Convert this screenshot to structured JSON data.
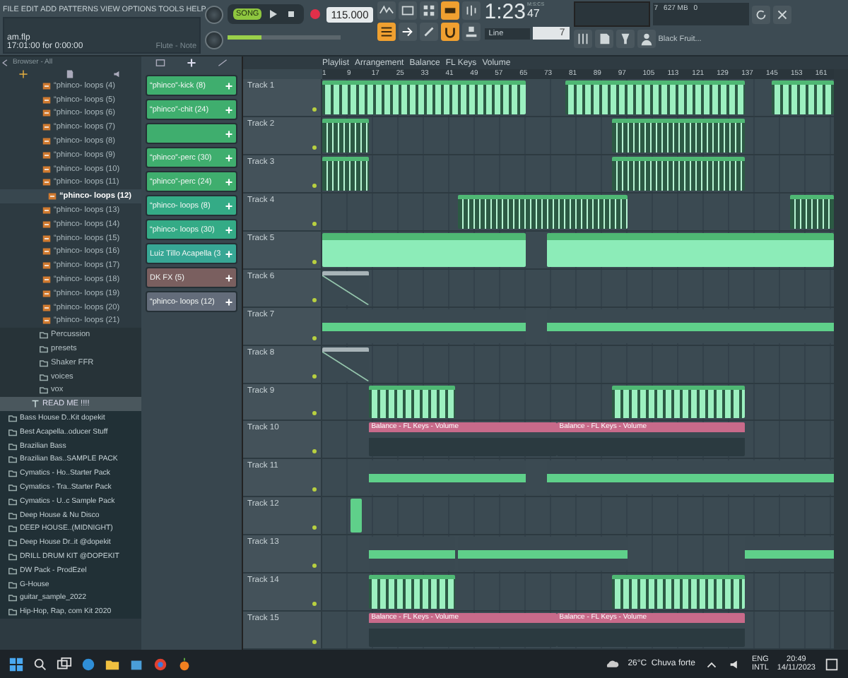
{
  "menu": [
    "FILE",
    "EDIT",
    "ADD",
    "PATTERNS",
    "VIEW",
    "OPTIONS",
    "TOOLS",
    "HELP"
  ],
  "hint": {
    "title": "am.flp",
    "line": "17:01:00 for 0:00:00",
    "right": "Flute - Note"
  },
  "transport": {
    "song": {
      "label": "SONG",
      "on": true
    },
    "tempo": "115.000",
    "time": "1:23",
    "time_small": "47",
    "time_unit": "M:S:CS",
    "master_volume": {
      "level": 0.3
    }
  },
  "monitor": {
    "voices": "7",
    "memory": "627 MB",
    "cpu": "0"
  },
  "snap": {
    "value": "Line"
  },
  "pattern": {
    "value": "7"
  },
  "preset": {
    "value": "Black Fruit..."
  },
  "browser": {
    "title": "Browser - All",
    "loops": [
      {
        "label": "“phinco- loops (4)",
        "selected": false
      },
      {
        "label": "“phinco- loops (5)",
        "selected": false
      },
      {
        "label": "“phinco- loops (6)",
        "selected": false
      },
      {
        "label": "“phinco- loops (7)",
        "selected": false
      },
      {
        "label": "“phinco- loops (8)",
        "selected": false
      },
      {
        "label": "“phinco- loops (9)",
        "selected": false
      },
      {
        "label": "“phinco- loops (10)",
        "selected": false
      },
      {
        "label": "“phinco- loops (11)",
        "selected": false
      },
      {
        "label": "“phinco- loops (12)",
        "selected": true
      },
      {
        "label": "“phinco- loops (13)",
        "selected": false
      },
      {
        "label": "“phinco- loops (14)",
        "selected": false
      },
      {
        "label": "“phinco- loops (15)",
        "selected": false
      },
      {
        "label": "“phinco- loops (16)",
        "selected": false
      },
      {
        "label": "“phinco- loops (17)",
        "selected": false
      },
      {
        "label": "“phinco- loops (18)",
        "selected": false
      },
      {
        "label": "“phinco- loops (19)",
        "selected": false
      },
      {
        "label": "“phinco- loops (20)",
        "selected": false
      },
      {
        "label": "“phinco- loops (21)",
        "selected": false
      }
    ],
    "folders": [
      {
        "label": "Percussion",
        "kind": "folder"
      },
      {
        "label": "presets",
        "kind": "folder"
      },
      {
        "label": "Shaker FFR",
        "kind": "folder"
      },
      {
        "label": "voices",
        "kind": "folder"
      },
      {
        "label": "vox",
        "kind": "folder"
      },
      {
        "label": "READ ME !!!!",
        "kind": "file"
      }
    ],
    "root_folders": [
      "Bass House D..Kit dopekit",
      "Best Acapella..oducer Stuff",
      "Brazilian Bass",
      "Brazilian Bas..SAMPLE PACK",
      "Cymatics - Ho..Starter Pack",
      "Cymatics - Tra..Starter Pack",
      "Cymatics - U..c Sample Pack",
      "Deep House & Nu Disco",
      "DEEP HOUSE..(MIDNIGHT)",
      "Deep House Dr..it @dopekit",
      "DRILL DRUM KIT @DOPEKIT",
      "DW Pack - ProdEzel",
      "G-House",
      "guitar_sample_2022",
      "Hip-Hop, Rap, com Kit 2020"
    ]
  },
  "channels": [
    {
      "name": "“phinco”-kick (8)",
      "color": "#3fae6e"
    },
    {
      "name": "“phinco”-chit (24)",
      "color": "#3fae6e"
    },
    {
      "color": "#3fae6e"
    },
    {
      "name": "“phinco”-perc (30)",
      "color": "#3fae6e"
    },
    {
      "name": "“phinco”-perc (24)",
      "color": "#3fae6e"
    },
    {
      "name": "“phinco- loops (8)",
      "color": "#34ab86"
    },
    {
      "name": "“phinco- loops (30)",
      "color": "#34ab86"
    },
    {
      "name": "Luiz Tillo Acapella (3",
      "color": "#37a795"
    },
    {
      "name": "DK FX (5)",
      "color": "#7a5f5f"
    },
    {
      "name": "“phinco- loops (12)",
      "color": "#636c7a"
    }
  ],
  "playlist": {
    "title": [
      "Playlist",
      "Arrangement",
      "Balance",
      "FL Keys",
      "Volume"
    ],
    "ruler": [
      "1",
      "9",
      "17",
      "25",
      "33",
      "41",
      "49",
      "57",
      "65",
      "73",
      "81",
      "89",
      "97",
      "105",
      "113",
      "121",
      "129",
      "137",
      "145",
      "153",
      "161"
    ],
    "tracks": [
      {
        "name": "Track 1"
      },
      {
        "name": "Track 2"
      },
      {
        "name": "Track 3"
      },
      {
        "name": "Track 4"
      },
      {
        "name": "Track 5"
      },
      {
        "name": "Track 6"
      },
      {
        "name": "Track 7"
      },
      {
        "name": "Track 8"
      },
      {
        "name": "Track 9"
      },
      {
        "name": "Track 10",
        "clip_labels": [
          "Balance - FL Keys - Volume",
          "Balance - FL Keys - Volume"
        ]
      },
      {
        "name": "Track 11"
      },
      {
        "name": "Track 12"
      },
      {
        "name": "Track 13"
      },
      {
        "name": "Track 14"
      },
      {
        "name": "Track 15",
        "clip_labels": [
          "Balance - FL Keys - Volume",
          "Balance - FL Keys - Volume"
        ]
      }
    ]
  },
  "taskbar": {
    "weather": "26°C  Chuva forte",
    "lang": "ENG",
    "layout": "INTL",
    "time": "20:49",
    "date": "14/11/2023"
  }
}
